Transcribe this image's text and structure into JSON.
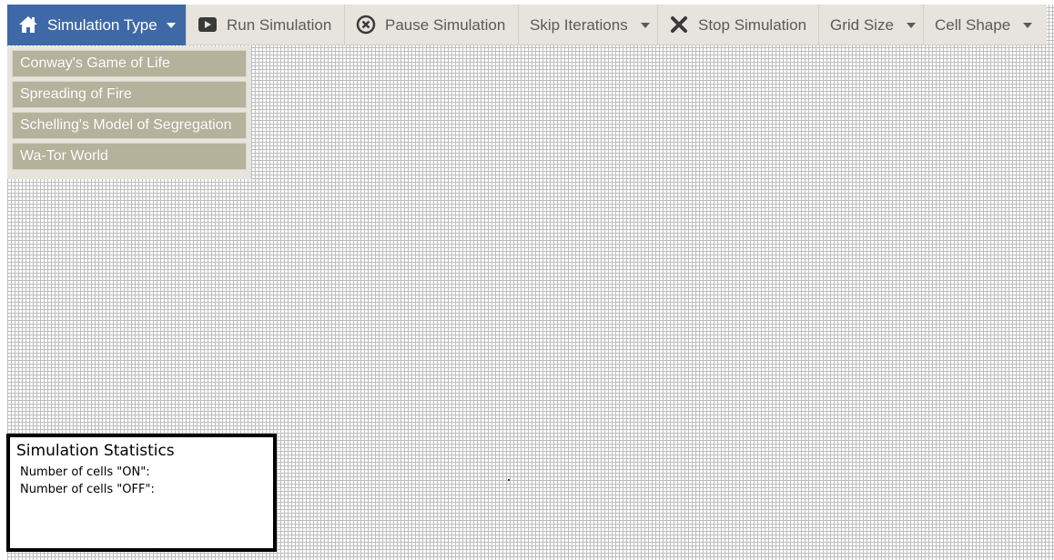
{
  "toolbar": {
    "items": [
      {
        "label": "Simulation Type",
        "icon": "home-icon",
        "has_caret": true,
        "active": true
      },
      {
        "label": "Run Simulation",
        "icon": "play-icon",
        "has_caret": false
      },
      {
        "label": "Pause Simulation",
        "icon": "pause-circle-icon",
        "has_caret": false
      },
      {
        "label": "Skip Iterations",
        "icon": "",
        "has_caret": true
      },
      {
        "label": "Stop Simulation",
        "icon": "close-icon",
        "has_caret": false
      },
      {
        "label": "Grid Size",
        "icon": "",
        "has_caret": true
      },
      {
        "label": "Cell Shape",
        "icon": "",
        "has_caret": true
      }
    ],
    "active_color": "#3f69a6",
    "bg_color": "#e6e4dc"
  },
  "dropdown": {
    "items": [
      "Conway's Game of Life",
      "Spreading of Fire",
      "Schelling's Model of Segregation",
      "Wa-Tor World"
    ],
    "item_color": "#b5b29c"
  },
  "stats": {
    "title": "Simulation Statistics",
    "cells_on_label": "Number of cells \"ON\":",
    "cells_off_label": "Number of cells \"OFF\":"
  }
}
